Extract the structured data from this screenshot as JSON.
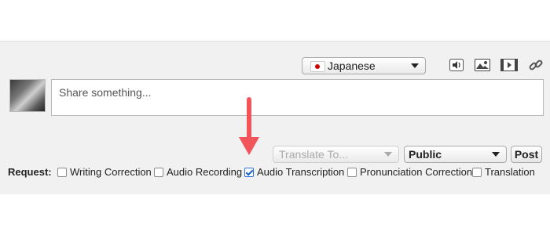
{
  "toolbar": {
    "language": "Japanese",
    "icons": [
      "speaker-icon",
      "image-icon",
      "video-icon",
      "link-icon"
    ]
  },
  "composer": {
    "placeholder": "Share something..."
  },
  "options": {
    "translate_placeholder": "Translate To...",
    "visibility": "Public",
    "post_label": "Post"
  },
  "request": {
    "label": "Request:",
    "items": [
      {
        "label": "Writing Correction",
        "checked": false
      },
      {
        "label": "Audio Recording",
        "checked": false
      },
      {
        "label": "Audio Transcription",
        "checked": true
      },
      {
        "label": "Pronunciation Correction",
        "checked": false
      },
      {
        "label": "Translation",
        "checked": false
      }
    ]
  },
  "colors": {
    "arrow": "#f2545b",
    "panel": "#f1f1f1",
    "flag_red": "#d40000"
  }
}
